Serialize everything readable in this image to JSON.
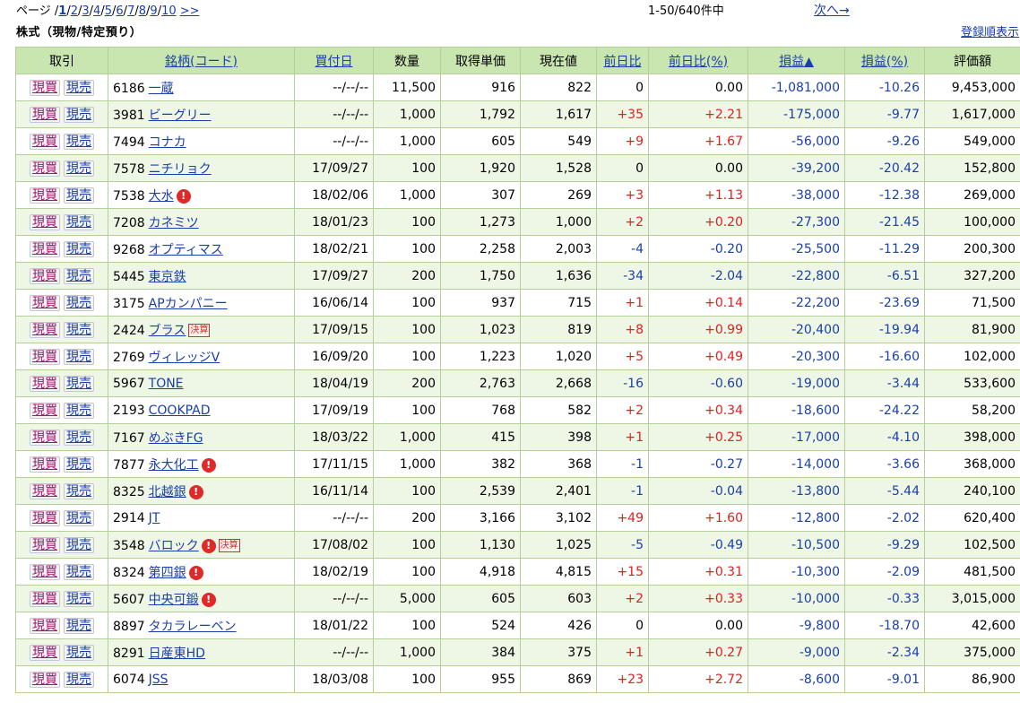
{
  "header": {
    "page_prefix": "ページ /",
    "pages": [
      "1",
      "2",
      "3",
      "4",
      "5",
      "6",
      "7",
      "8",
      "9",
      "10"
    ],
    "current_page": "1",
    "more_pages": ">>",
    "count_text": "1-50/640件中",
    "next_label": "次へ→",
    "title": "株式（現物/特定預り）",
    "sort_label": "登録順表示"
  },
  "table": {
    "columns": [
      "取引",
      "銘柄(コード)",
      "買付日",
      "数量",
      "取得単価",
      "現在値",
      "前日比",
      "前日比(%)",
      "損益▲",
      "損益(%)",
      "評価額"
    ],
    "buy_label": "現買",
    "sell_label": "現売",
    "warn_icon": "!",
    "settle_label": "決算",
    "rows": [
      {
        "code": "6186",
        "name": "一蔵",
        "date": "--/--/--",
        "qty": "11,500",
        "cost": "916",
        "price": "822",
        "chg": "0",
        "chgp": "0.00",
        "pl": "-1,081,000",
        "plp": "-10.26",
        "val": "9,453,000",
        "warn": false,
        "settle": false
      },
      {
        "code": "3981",
        "name": "ビーグリー",
        "date": "--/--/--",
        "qty": "1,000",
        "cost": "1,792",
        "price": "1,617",
        "chg": "+35",
        "chgp": "+2.21",
        "pl": "-175,000",
        "plp": "-9.77",
        "val": "1,617,000",
        "warn": false,
        "settle": false
      },
      {
        "code": "7494",
        "name": "コナカ",
        "date": "--/--/--",
        "qty": "1,000",
        "cost": "605",
        "price": "549",
        "chg": "+9",
        "chgp": "+1.67",
        "pl": "-56,000",
        "plp": "-9.26",
        "val": "549,000",
        "warn": false,
        "settle": false
      },
      {
        "code": "7578",
        "name": "ニチリョク",
        "date": "17/09/27",
        "qty": "100",
        "cost": "1,920",
        "price": "1,528",
        "chg": "0",
        "chgp": "0.00",
        "pl": "-39,200",
        "plp": "-20.42",
        "val": "152,800",
        "warn": false,
        "settle": false
      },
      {
        "code": "7538",
        "name": "大水",
        "date": "18/02/06",
        "qty": "1,000",
        "cost": "307",
        "price": "269",
        "chg": "+3",
        "chgp": "+1.13",
        "pl": "-38,000",
        "plp": "-12.38",
        "val": "269,000",
        "warn": true,
        "settle": false
      },
      {
        "code": "7208",
        "name": "カネミツ",
        "date": "18/01/23",
        "qty": "100",
        "cost": "1,273",
        "price": "1,000",
        "chg": "+2",
        "chgp": "+0.20",
        "pl": "-27,300",
        "plp": "-21.45",
        "val": "100,000",
        "warn": false,
        "settle": false
      },
      {
        "code": "9268",
        "name": "オプティマス",
        "date": "18/02/21",
        "qty": "100",
        "cost": "2,258",
        "price": "2,003",
        "chg": "-4",
        "chgp": "-0.20",
        "pl": "-25,500",
        "plp": "-11.29",
        "val": "200,300",
        "warn": false,
        "settle": false
      },
      {
        "code": "5445",
        "name": "東京鉄",
        "date": "17/09/27",
        "qty": "200",
        "cost": "1,750",
        "price": "1,636",
        "chg": "-34",
        "chgp": "-2.04",
        "pl": "-22,800",
        "plp": "-6.51",
        "val": "327,200",
        "warn": false,
        "settle": false
      },
      {
        "code": "3175",
        "name": "APカンパニー",
        "date": "16/06/14",
        "qty": "100",
        "cost": "937",
        "price": "715",
        "chg": "+1",
        "chgp": "+0.14",
        "pl": "-22,200",
        "plp": "-23.69",
        "val": "71,500",
        "warn": false,
        "settle": false
      },
      {
        "code": "2424",
        "name": "ブラス",
        "date": "17/09/15",
        "qty": "100",
        "cost": "1,023",
        "price": "819",
        "chg": "+8",
        "chgp": "+0.99",
        "pl": "-20,400",
        "plp": "-19.94",
        "val": "81,900",
        "warn": false,
        "settle": true
      },
      {
        "code": "2769",
        "name": "ヴィレッジV",
        "date": "16/09/20",
        "qty": "100",
        "cost": "1,223",
        "price": "1,020",
        "chg": "+5",
        "chgp": "+0.49",
        "pl": "-20,300",
        "plp": "-16.60",
        "val": "102,000",
        "warn": false,
        "settle": false
      },
      {
        "code": "5967",
        "name": "TONE",
        "date": "18/04/19",
        "qty": "200",
        "cost": "2,763",
        "price": "2,668",
        "chg": "-16",
        "chgp": "-0.60",
        "pl": "-19,000",
        "plp": "-3.44",
        "val": "533,600",
        "warn": false,
        "settle": false
      },
      {
        "code": "2193",
        "name": "COOKPAD",
        "date": "17/09/19",
        "qty": "100",
        "cost": "768",
        "price": "582",
        "chg": "+2",
        "chgp": "+0.34",
        "pl": "-18,600",
        "plp": "-24.22",
        "val": "58,200",
        "warn": false,
        "settle": false
      },
      {
        "code": "7167",
        "name": "めぶきFG",
        "date": "18/03/22",
        "qty": "1,000",
        "cost": "415",
        "price": "398",
        "chg": "+1",
        "chgp": "+0.25",
        "pl": "-17,000",
        "plp": "-4.10",
        "val": "398,000",
        "warn": false,
        "settle": false
      },
      {
        "code": "7877",
        "name": "永大化工",
        "date": "17/11/15",
        "qty": "1,000",
        "cost": "382",
        "price": "368",
        "chg": "-1",
        "chgp": "-0.27",
        "pl": "-14,000",
        "plp": "-3.66",
        "val": "368,000",
        "warn": true,
        "settle": false
      },
      {
        "code": "8325",
        "name": "北越銀",
        "date": "16/11/14",
        "qty": "100",
        "cost": "2,539",
        "price": "2,401",
        "chg": "-1",
        "chgp": "-0.04",
        "pl": "-13,800",
        "plp": "-5.44",
        "val": "240,100",
        "warn": true,
        "settle": false
      },
      {
        "code": "2914",
        "name": "JT",
        "date": "--/--/--",
        "qty": "200",
        "cost": "3,166",
        "price": "3,102",
        "chg": "+49",
        "chgp": "+1.60",
        "pl": "-12,800",
        "plp": "-2.02",
        "val": "620,400",
        "warn": false,
        "settle": false
      },
      {
        "code": "3548",
        "name": "バロック",
        "date": "17/08/02",
        "qty": "100",
        "cost": "1,130",
        "price": "1,025",
        "chg": "-5",
        "chgp": "-0.49",
        "pl": "-10,500",
        "plp": "-9.29",
        "val": "102,500",
        "warn": true,
        "settle": true
      },
      {
        "code": "8324",
        "name": "第四銀",
        "date": "18/02/19",
        "qty": "100",
        "cost": "4,918",
        "price": "4,815",
        "chg": "+15",
        "chgp": "+0.31",
        "pl": "-10,300",
        "plp": "-2.09",
        "val": "481,500",
        "warn": true,
        "settle": false
      },
      {
        "code": "5607",
        "name": "中央可鍛",
        "date": "--/--/--",
        "qty": "5,000",
        "cost": "605",
        "price": "603",
        "chg": "+2",
        "chgp": "+0.33",
        "pl": "-10,000",
        "plp": "-0.33",
        "val": "3,015,000",
        "warn": true,
        "settle": false
      },
      {
        "code": "8897",
        "name": "タカラレーベン",
        "date": "18/01/22",
        "qty": "100",
        "cost": "524",
        "price": "426",
        "chg": "0",
        "chgp": "0.00",
        "pl": "-9,800",
        "plp": "-18.70",
        "val": "42,600",
        "warn": false,
        "settle": false
      },
      {
        "code": "8291",
        "name": "日産東HD",
        "date": "--/--/--",
        "qty": "1,000",
        "cost": "384",
        "price": "375",
        "chg": "+1",
        "chgp": "+0.27",
        "pl": "-9,000",
        "plp": "-2.34",
        "val": "375,000",
        "warn": false,
        "settle": false
      },
      {
        "code": "6074",
        "name": "JSS",
        "date": "18/03/08",
        "qty": "100",
        "cost": "955",
        "price": "869",
        "chg": "+23",
        "chgp": "+2.72",
        "pl": "-8,600",
        "plp": "-9.01",
        "val": "86,900",
        "warn": false,
        "settle": false
      }
    ]
  },
  "colors": {
    "header_bg": "#c9e5b0",
    "row_alt_bg": "#eef7e6",
    "border": "#b5cf9a",
    "link": "#1a3fa8",
    "positive": "#e02020",
    "negative": "#1a3fa8",
    "buy": "#a0156f"
  }
}
